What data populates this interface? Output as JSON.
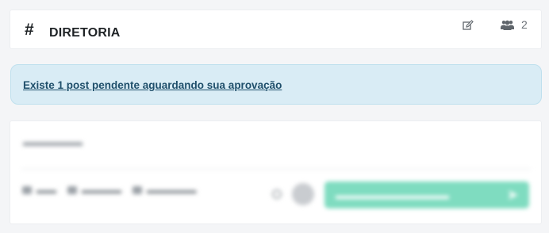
{
  "channel": {
    "hash": "#",
    "name": "DIRETORIA",
    "members_count": "2"
  },
  "pending": {
    "message": "Existe 1 post pendente aguardando sua aprovação"
  },
  "colors": {
    "alert_bg": "#d9ecf5",
    "alert_text": "#1f4f6b",
    "publish_button": "#7fdcc0"
  }
}
